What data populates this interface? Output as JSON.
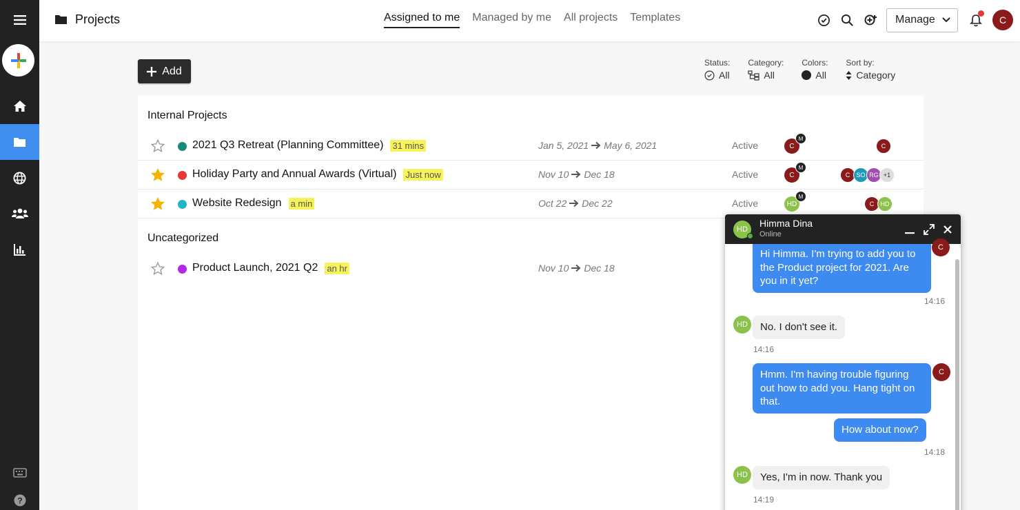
{
  "header": {
    "title": "Projects",
    "tabs": [
      {
        "label": "Assigned to me",
        "active": true
      },
      {
        "label": "Managed by me"
      },
      {
        "label": "All projects"
      },
      {
        "label": "Templates"
      }
    ],
    "manage_label": "Manage",
    "user_initial": "C"
  },
  "toolbar": {
    "add_label": "Add",
    "filters": {
      "status": {
        "label": "Status:",
        "value": "All"
      },
      "category": {
        "label": "Category:",
        "value": "All"
      },
      "colors": {
        "label": "Colors:",
        "value": "All"
      },
      "sort": {
        "label": "Sort by:",
        "value": "Category"
      }
    }
  },
  "sections": [
    {
      "title": "Internal Projects",
      "projects": [
        {
          "name": "2021 Q3 Retreat (Planning Committee)",
          "badge": "31 mins",
          "starred": false,
          "color": "#168a7a",
          "start": "Jan 5, 2021",
          "end": "May 6, 2021",
          "status": "Active",
          "owner": "C",
          "owner_role": "M",
          "members": [
            "C"
          ]
        },
        {
          "name": "Holiday Party and Annual Awards (Virtual)",
          "badge": "Just now",
          "starred": true,
          "color": "#e53935",
          "start": "Nov 10",
          "end": "Dec 18",
          "status": "Active",
          "owner": "C",
          "owner_role": "M",
          "members": [
            "C",
            "SO",
            "RG",
            "+1"
          ]
        },
        {
          "name": "Website Redesign",
          "badge": "a min",
          "starred": true,
          "color": "#22b3c9",
          "start": "Oct 22",
          "end": "Dec 22",
          "status": "Active",
          "owner": "HD",
          "owner_role": "M",
          "members": [
            "C",
            "HD"
          ]
        }
      ]
    },
    {
      "title": "Uncategorized",
      "projects": [
        {
          "name": "Product Launch, 2021 Q2",
          "badge": "an hr",
          "starred": false,
          "color": "#b32be6",
          "start": "Nov 10",
          "end": "Dec 18"
        }
      ]
    }
  ],
  "chat": {
    "name": "Himma Dina",
    "status": "Online",
    "initials": "HD",
    "me_initial": "C",
    "messages": [
      {
        "from": "me",
        "text": "Hi Himma. I'm trying to add you to the Product project for 2021. Are you in it yet?",
        "time": "14:16"
      },
      {
        "from": "them",
        "text": "No. I don't see it.",
        "time": "14:16"
      },
      {
        "from": "me",
        "text": "Hmm. I'm having trouble figuring out how to add you. Hang tight on that."
      },
      {
        "from": "me",
        "text": "How about now?",
        "time": "14:18"
      },
      {
        "from": "them",
        "text": "Yes, I'm in now. Thank you",
        "time": "14:19"
      }
    ]
  }
}
